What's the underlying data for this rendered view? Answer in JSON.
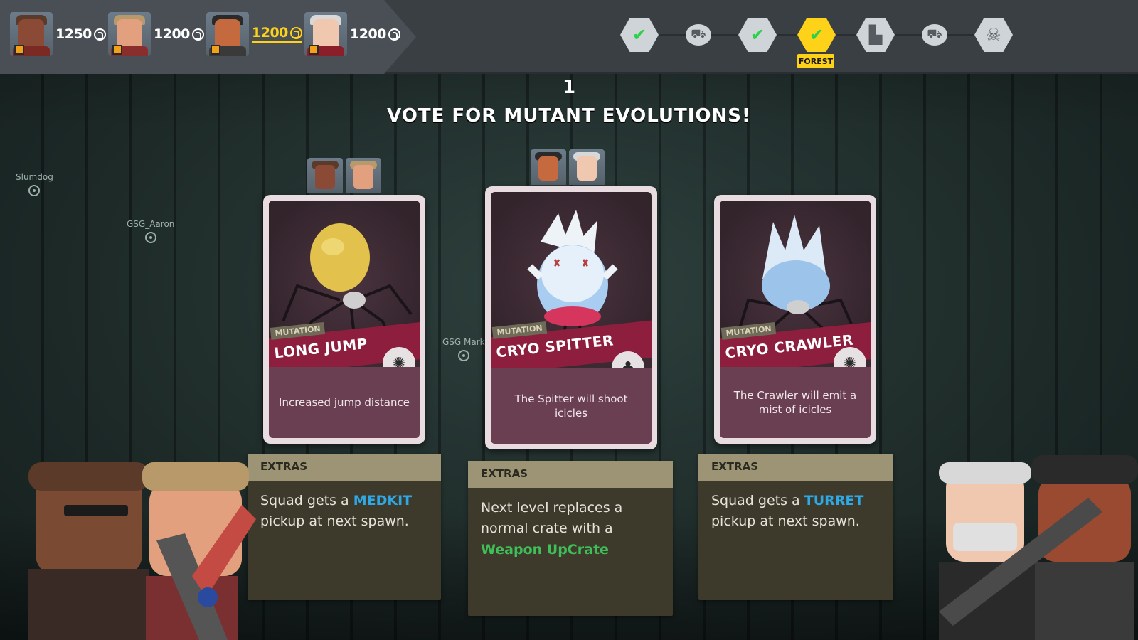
{
  "players": [
    {
      "credits": "1250",
      "active": false,
      "skin": "#8a4a35",
      "hat": "#5b3a2a",
      "shirt": "#7a2a22"
    },
    {
      "credits": "1200",
      "active": false,
      "skin": "#e3a07e",
      "hat": "#b89a6a",
      "shirt": "#8a2d2d"
    },
    {
      "credits": "1200",
      "active": true,
      "skin": "#c46a3e",
      "hat": "#2a2a2a",
      "shirt": "#3a3a3a"
    },
    {
      "credits": "1200",
      "active": false,
      "skin": "#f0c8b0",
      "hat": "#d8d8d8",
      "shirt": "#8a1f2a"
    }
  ],
  "progress": {
    "nodes": [
      {
        "icon": "checkmark-icon",
        "glyph": "✔",
        "done": true,
        "shape": "hex"
      },
      {
        "icon": "cart-icon",
        "glyph": "🛒",
        "done": false,
        "shape": "circle"
      },
      {
        "icon": "checkmark-icon",
        "glyph": "✔",
        "done": true,
        "shape": "hex"
      },
      {
        "icon": "checkmark-icon",
        "glyph": "✔",
        "done": true,
        "shape": "hex",
        "current": true
      },
      {
        "icon": "factory-icon",
        "glyph": "🏭",
        "done": false,
        "shape": "hex"
      },
      {
        "icon": "cart-icon",
        "glyph": "🛒",
        "done": false,
        "shape": "circle"
      },
      {
        "icon": "skull-icon",
        "glyph": "☠",
        "done": false,
        "shape": "hex"
      }
    ],
    "current_label": "FOREST"
  },
  "timer": "1",
  "heading": "VOTE FOR MUTANT EVOLUTIONS!",
  "cursors": [
    {
      "name": "Slumdog"
    },
    {
      "name": "GSG_Aaron"
    },
    {
      "name": "GSG Mark"
    }
  ],
  "cards": [
    {
      "tag": "MUTATION",
      "title": "LONG JUMP",
      "description": "Increased jump distance",
      "creature": "spider-egg",
      "extras_title": "EXTRAS",
      "extras_pre": "Squad gets a ",
      "extras_keyword": "MEDKIT",
      "extras_post": " pickup at next spawn."
    },
    {
      "tag": "MUTATION",
      "title": "CRYO SPITTER",
      "description": "The Spitter will shoot icicles",
      "creature": "spitter",
      "extras_title": "EXTRAS",
      "extras_pre": "Next level replaces a normal crate with a ",
      "extras_keyword": "Weapon UpCrate",
      "extras_post": ""
    },
    {
      "tag": "MUTATION",
      "title": "CRYO CRAWLER",
      "description": "The Crawler will emit a mist of icicles",
      "creature": "crawler",
      "extras_title": "EXTRAS",
      "extras_pre": "Squad gets a ",
      "extras_keyword": "TURRET",
      "extras_post": " pickup at next spawn."
    }
  ],
  "colors": {
    "accent_yellow": "#ffd21a",
    "card_banner": "#8e1e3e",
    "keyword_blue": "#2fa9e6",
    "keyword_green": "#3fbf58",
    "done_green": "#2bd14a"
  }
}
